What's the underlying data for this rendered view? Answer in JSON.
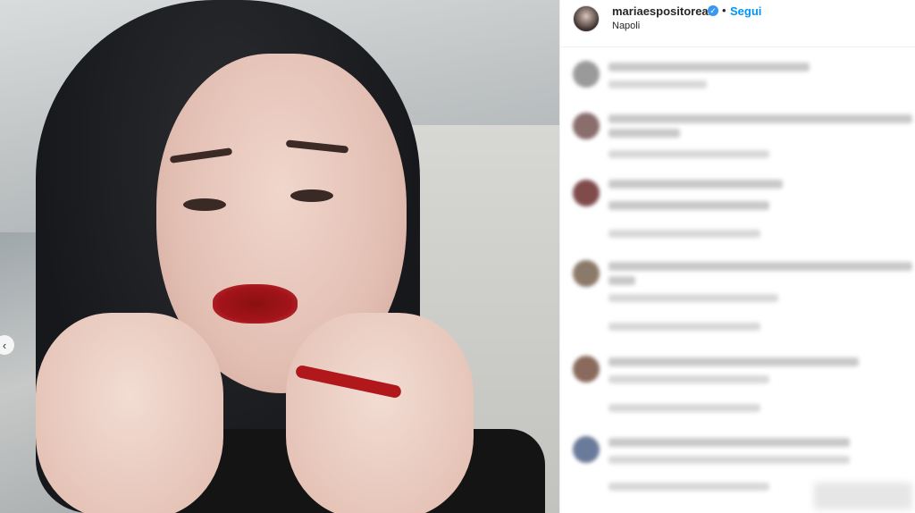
{
  "post": {
    "image_alt": "photo",
    "nav_prev_icon": "chevron-left-icon"
  },
  "header": {
    "username": "mariaespositoreal",
    "verified_icon": "verified-badge-icon",
    "separator": "•",
    "follow_label": "Segui",
    "location": "Napoli"
  },
  "comments": [
    {
      "avatar_color": "#9a9a9a"
    },
    {
      "avatar_color": "#8a6d6d"
    },
    {
      "avatar_color": "#7f4b4b"
    },
    {
      "avatar_color": "#8b7a6a"
    },
    {
      "avatar_color": "#8a6a5d"
    },
    {
      "avatar_color": "#6a7a9a"
    }
  ],
  "colors": {
    "follow_blue": "#0095f6",
    "verified_blue": "#3897f0"
  }
}
